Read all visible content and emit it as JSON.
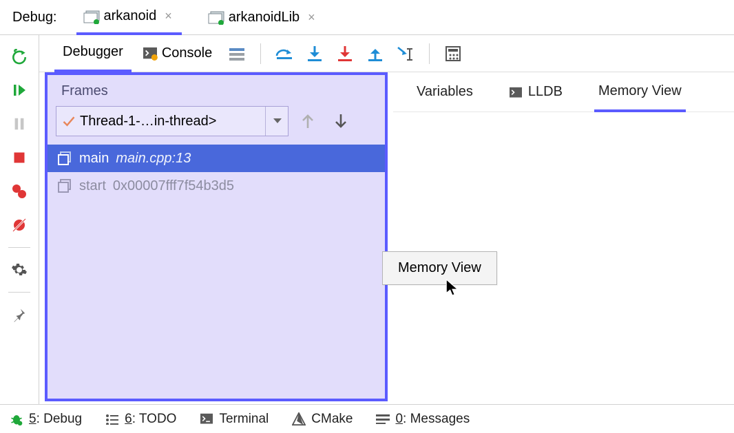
{
  "topbar": {
    "label": "Debug:"
  },
  "tabs": [
    {
      "label": "arkanoid",
      "active": true
    },
    {
      "label": "arkanoidLib",
      "active": false
    }
  ],
  "toolbar": {
    "debugger": "Debugger",
    "console": "Console"
  },
  "frames": {
    "title": "Frames",
    "thread": "Thread-1-…in-thread>",
    "rows": [
      {
        "name": "main",
        "loc": "main.cpp:13"
      },
      {
        "name": "start",
        "addr": "0x00007fff7f54b3d5"
      }
    ]
  },
  "right_tabs": {
    "variables": "Variables",
    "lldb": "LLDB",
    "memory": "Memory View"
  },
  "popup": {
    "memory_view": "Memory View"
  },
  "status": {
    "debug_pre": "5",
    "debug_txt": ": Debug",
    "todo_pre": "6",
    "todo_txt": ": TODO",
    "terminal": "Terminal",
    "cmake": "CMake",
    "msg_pre": "0",
    "msg_txt": ": Messages"
  }
}
